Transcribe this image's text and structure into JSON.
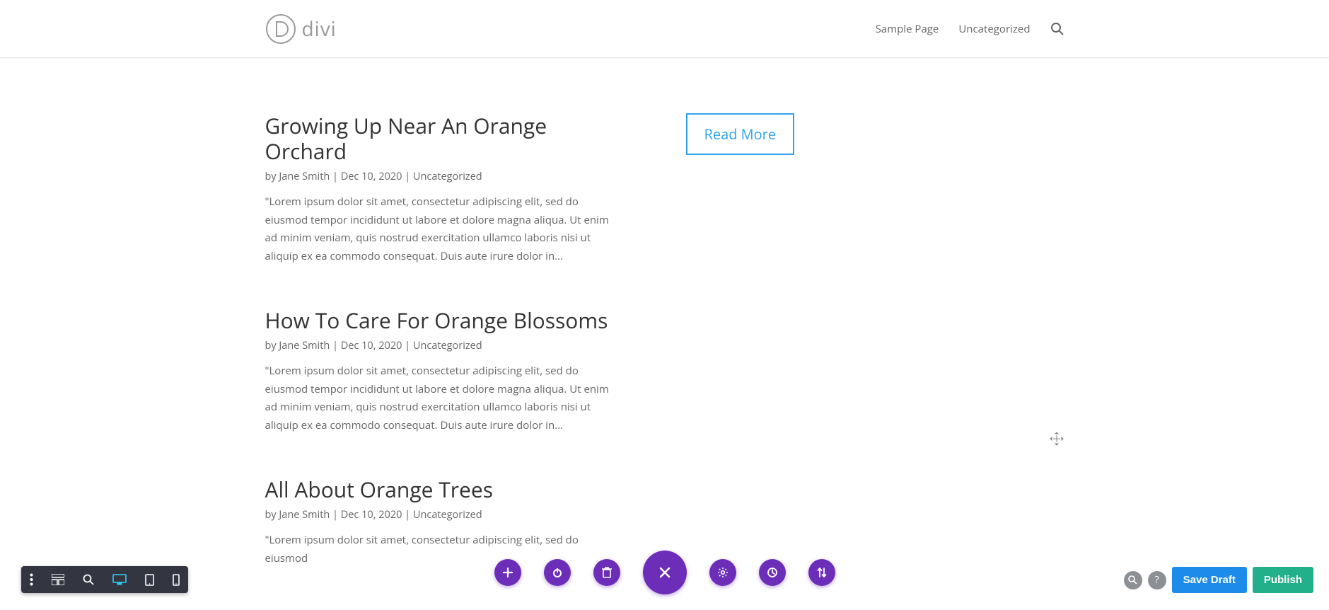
{
  "brand": "divi",
  "nav": {
    "items": [
      "Sample Page",
      "Uncategorized"
    ]
  },
  "posts": [
    {
      "title": "Growing Up Near An Orange Orchard",
      "by": "by ",
      "author": "Jane Smith",
      "sep1": " | ",
      "date": "Dec 10, 2020",
      "sep2": " | ",
      "category": "Uncategorized",
      "excerpt": "\"Lorem ipsum dolor sit amet, consectetur adipiscing elit, sed do eiusmod tempor incididunt ut labore et dolore magna aliqua. Ut enim ad minim veniam, quis nostrud exercitation ullamco laboris nisi ut aliquip ex ea commodo consequat. Duis aute irure dolor in..."
    },
    {
      "title": "How To Care For Orange Blossoms",
      "by": "by ",
      "author": "Jane Smith",
      "sep1": " | ",
      "date": "Dec 10, 2020",
      "sep2": " | ",
      "category": "Uncategorized",
      "excerpt": "\"Lorem ipsum dolor sit amet, consectetur adipiscing elit, sed do eiusmod tempor incididunt ut labore et dolore magna aliqua. Ut enim ad minim veniam, quis nostrud exercitation ullamco laboris nisi ut aliquip ex ea commodo consequat. Duis aute irure dolor in..."
    },
    {
      "title": "All About Orange Trees",
      "by": "by ",
      "author": "Jane Smith",
      "sep1": " | ",
      "date": "Dec 10, 2020",
      "sep2": " | ",
      "category": "Uncategorized",
      "excerpt": "\"Lorem ipsum dolor sit amet, consectetur adipiscing elit, sed do eiusmod"
    }
  ],
  "readmore_label": "Read More",
  "editor": {
    "save_label": "Save Draft",
    "publish_label": "Publish",
    "help_label": "?"
  },
  "colors": {
    "accent_blue": "#2ea3f2",
    "builder_purple": "#6c2eb9",
    "toolbar_dark": "#333641",
    "save_blue": "#1d8bea",
    "publish_green": "#22b08a"
  }
}
